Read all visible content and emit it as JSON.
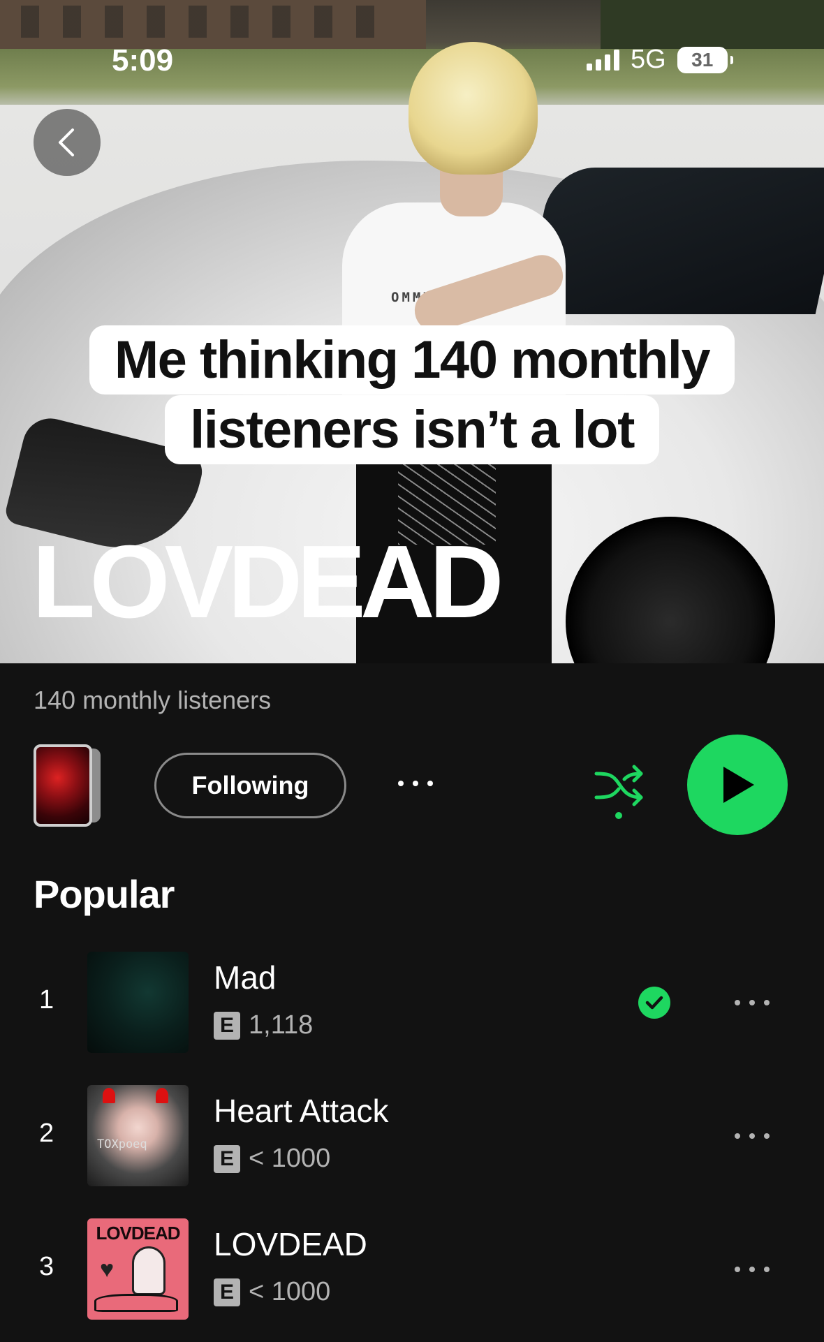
{
  "status_bar": {
    "time": "5:09",
    "network": "5G",
    "battery": "31"
  },
  "hero": {
    "caption_line1": "Me thinking 140 monthly",
    "caption_line2": "listeners isn’t a lot",
    "shirt_text": "OMMY  H IGE",
    "artist_name": "LOVDEAD"
  },
  "artist": {
    "monthly_listeners": "140 monthly listeners",
    "following_label": "Following"
  },
  "colors": {
    "accent": "#1ed760",
    "background": "#121212",
    "secondary_text": "#b3b3b3"
  },
  "popular": {
    "title": "Popular",
    "tracks": [
      {
        "rank": "1",
        "title": "Mad",
        "explicit": "E",
        "plays": "1,118",
        "saved": true
      },
      {
        "rank": "2",
        "title": "Heart Attack",
        "explicit": "E",
        "plays": "< 1000",
        "saved": false,
        "cover_caption": "TOXpoeq"
      },
      {
        "rank": "3",
        "title": "LOVDEAD",
        "explicit": "E",
        "plays": "< 1000",
        "saved": false,
        "cover_text": "LOVDEAD"
      }
    ]
  },
  "icons": {
    "back": "chevron-left-icon",
    "more": "more-horizontal-icon",
    "shuffle": "shuffle-icon",
    "play": "play-icon",
    "saved": "check-circle-icon"
  }
}
